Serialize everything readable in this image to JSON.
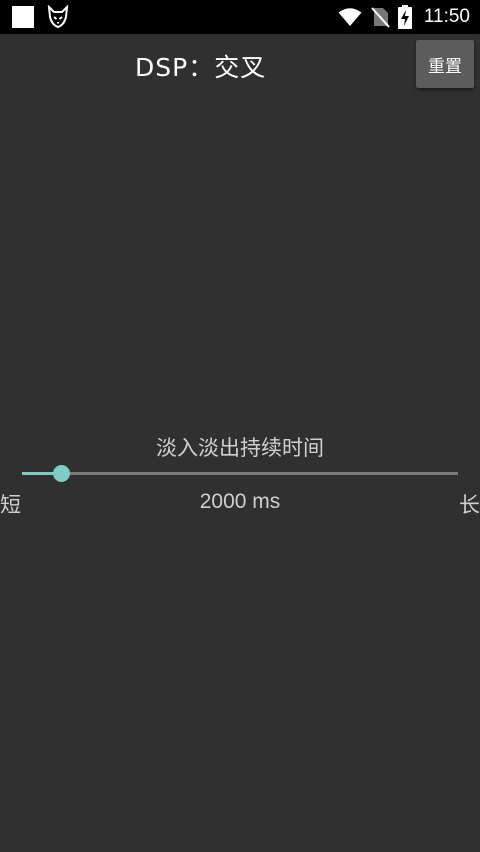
{
  "status_bar": {
    "time": "11:50",
    "icons": [
      "app-square-icon",
      "fox-app-icon",
      "wifi-icon",
      "no-sim-icon",
      "battery-charging-icon"
    ]
  },
  "header": {
    "title": "DSP：交叉",
    "reset_label": "重置"
  },
  "slider": {
    "label": "淡入淡出持续时间",
    "min_label": "短",
    "max_label": "长",
    "value_text": "2000 ms",
    "fraction": 0.09
  },
  "colors": {
    "background": "#303030",
    "accent": "#80cbc4",
    "button": "#5c5c5c"
  }
}
